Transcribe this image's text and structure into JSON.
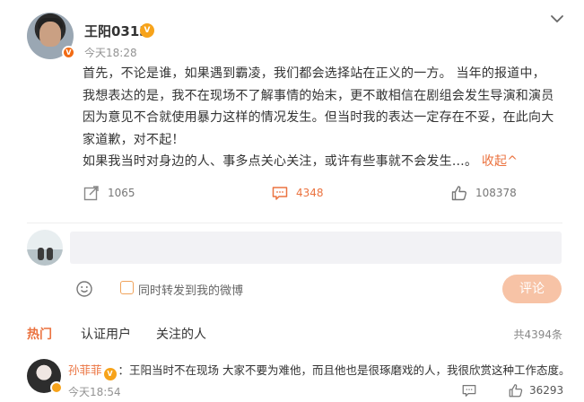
{
  "post": {
    "username": "王阳0313",
    "vip_icon_text": "V",
    "timestamp": "今天18:28",
    "content": [
      "首先，不论是谁，如果遇到霸凌，我们都会选择站在正义的一方。 当年的报道中，我想表达的是，我不在现场不了解事情的始末，更不敢相信在剧组会发生导演和演员因为意见不合就使用暴力这样的情况发生。但当时我的表达一定存在不妥，在此向大家道歉，对不起！",
      "如果我当时对身边的人、事多点关心关注，或许有些事就不会发生…。"
    ],
    "collapse_label": "收起^",
    "repost_count": "1065",
    "comment_count": "4348",
    "like_count": "108378"
  },
  "composer": {
    "placeholder": "",
    "repost_label": "同时转发到我的微博",
    "submit_label": "评论"
  },
  "tabs": {
    "items": [
      "热门",
      "认证用户",
      "关注的人"
    ],
    "total": "共4394条"
  },
  "reply": {
    "username": "孙菲菲",
    "text": "：王阳当时不在现场 大家不要为难他，而且他也是很琢磨戏的人，我很欣赏这种工作态度。",
    "timestamp": "今天18:54",
    "like_count": "36293"
  },
  "colors": {
    "accent": "#eb7340",
    "submit_disabled": "#f7c3a6",
    "input_bg": "#f2f2f5",
    "muted": "#939393"
  },
  "icons": {
    "more": "chevron-down-icon",
    "repost": "share-icon",
    "comment": "comment-icon",
    "like": "thumbs-up-icon",
    "emoji": "smiley-icon"
  }
}
